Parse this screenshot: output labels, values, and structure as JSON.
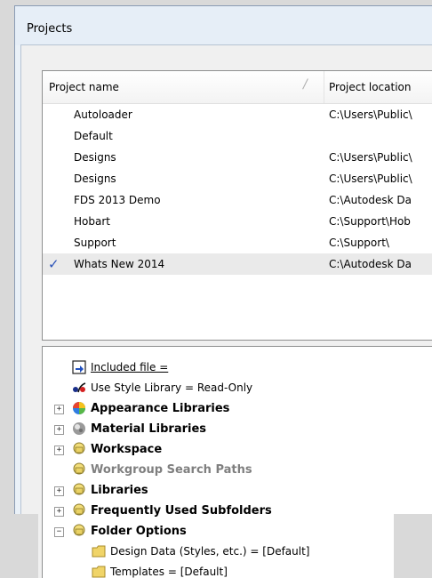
{
  "window": {
    "title": "Projects"
  },
  "projects": {
    "columns": {
      "name": "Project name",
      "location": "Project location"
    },
    "rows": [
      {
        "name": "Autoloader",
        "location": "C:\\Users\\Public\\",
        "active": false
      },
      {
        "name": "Default",
        "location": "",
        "active": false
      },
      {
        "name": "Designs",
        "location": "C:\\Users\\Public\\",
        "active": false
      },
      {
        "name": "Designs",
        "location": "C:\\Users\\Public\\",
        "active": false
      },
      {
        "name": "FDS 2013 Demo",
        "location": "C:\\Autodesk Da",
        "active": false
      },
      {
        "name": "Hobart",
        "location": "C:\\Support\\Hob",
        "active": false
      },
      {
        "name": "Support",
        "location": "C:\\Support\\",
        "active": false
      },
      {
        "name": "Whats New 2014",
        "location": "C:\\Autodesk Da",
        "active": true
      }
    ],
    "check_glyph": "✓"
  },
  "tree": {
    "items": [
      {
        "label": "Included file =",
        "icon": "included-file-icon"
      },
      {
        "label": "Use Style Library = Read-Only",
        "icon": "style-library-icon"
      },
      {
        "label": "Appearance Libraries",
        "icon": "appearance-sphere-icon",
        "expander": "+"
      },
      {
        "label": "Material Libraries",
        "icon": "material-sphere-icon",
        "expander": "+"
      },
      {
        "label": "Workspace",
        "icon": "folder-group-icon",
        "expander": "+"
      },
      {
        "label": "Workgroup Search Paths",
        "icon": "folder-group-icon"
      },
      {
        "label": "Libraries",
        "icon": "folder-group-icon",
        "expander": "+"
      },
      {
        "label": "Frequently Used Subfolders",
        "icon": "folder-group-icon",
        "expander": "+"
      },
      {
        "label": "Folder Options",
        "icon": "folder-group-icon",
        "expander": "−"
      },
      {
        "label": "Design Data (Styles, etc.) = [Default]",
        "icon": "folder-icon"
      },
      {
        "label": "Templates = [Default]",
        "icon": "folder-icon"
      }
    ]
  }
}
